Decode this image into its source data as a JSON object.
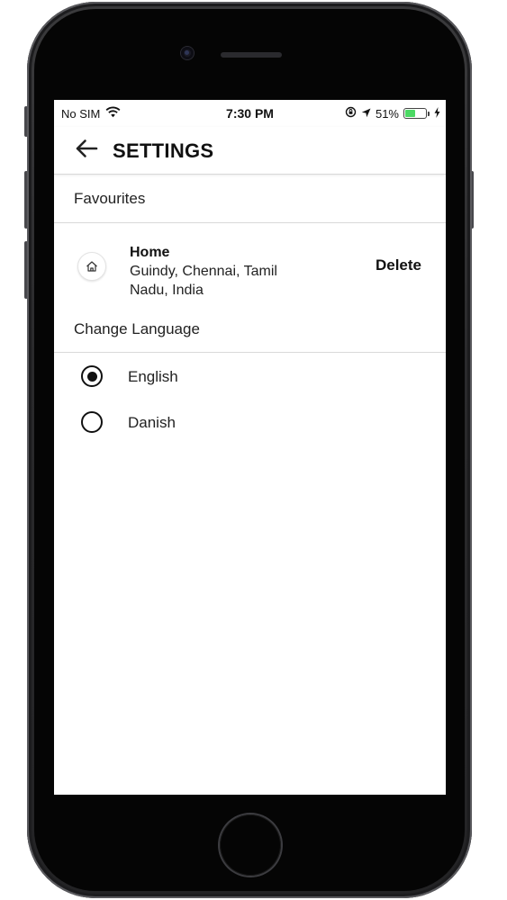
{
  "status_bar": {
    "carrier": "No SIM",
    "time": "7:30 PM",
    "battery_percent": "51%",
    "battery_level": 0.51,
    "icons": [
      "wifi-icon",
      "orientation-lock-icon",
      "location-arrow-icon",
      "battery-icon",
      "charging-bolt-icon"
    ]
  },
  "header": {
    "title": "SETTINGS",
    "back_icon": "arrow-left-icon"
  },
  "favourites": {
    "section_title": "Favourites",
    "items": [
      {
        "title": "Home",
        "address_line1": "Guindy, Chennai, Tamil",
        "address_line2": "Nadu, India",
        "icon": "home-icon",
        "action_label": "Delete"
      }
    ]
  },
  "language": {
    "section_title": "Change Language",
    "options": [
      {
        "label": "English",
        "selected": true
      },
      {
        "label": "Danish",
        "selected": false
      }
    ]
  },
  "colors": {
    "battery_fill": "#4cd964",
    "text": "#111111",
    "divider": "#d9d9d9"
  }
}
